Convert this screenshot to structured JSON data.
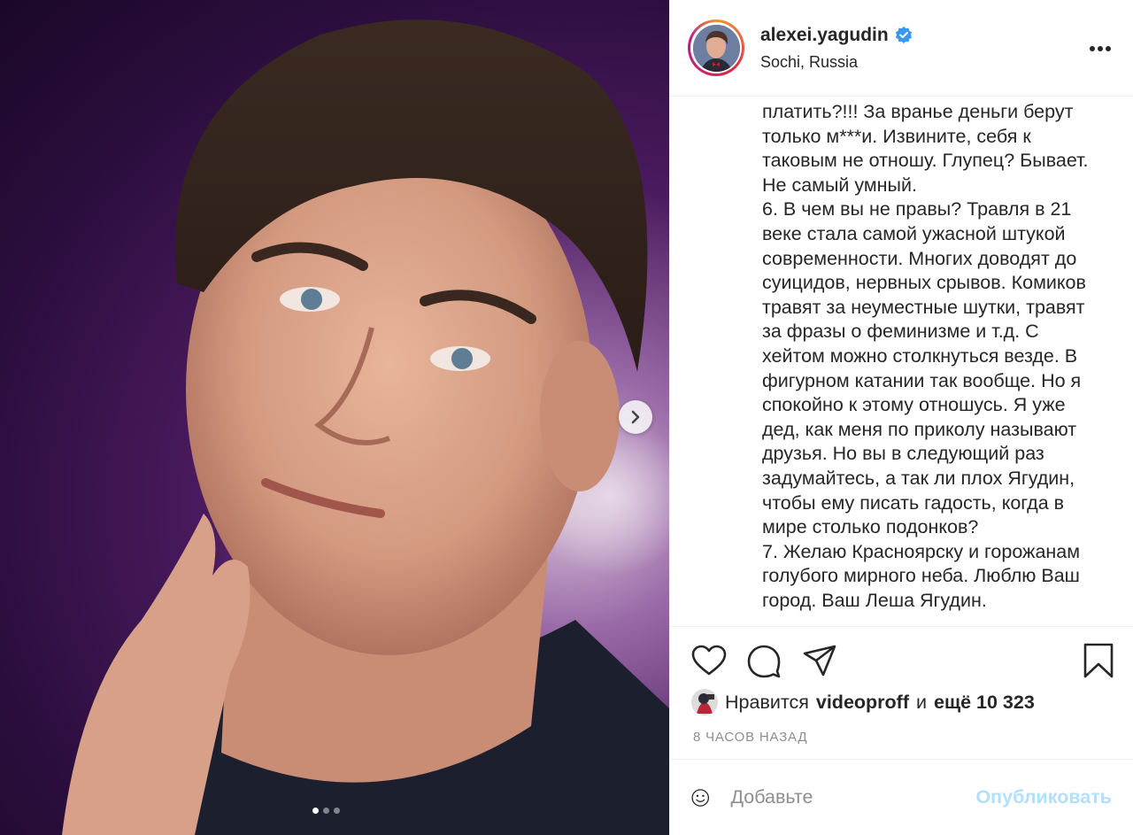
{
  "post": {
    "username": "alexei.yagudin",
    "location": "Sochi, Russia",
    "verified": true,
    "caption": "платить?!!! За вранье деньги берут\nтолько м***и. Извините, себя к\nтаковым не отношу. Глупец? Бывает.\nНе самый умный.\n6. В чем вы не правы? Травля в 21\nвеке стала самой ужасной штукой\nсовременности. Многих доводят до\nсуицидов, нервных срывов. Комиков\nтравят за неуместные шутки, травят\nза фразы о феминизме и т.д. С\nхейтом можно столкнуться везде. В\nфигурном катании так вообще. Но я\nспокойно к этому отношусь. Я уже\nдед, как меня по приколу называют\nдрузья. Но вы в следующий раз\nзадумайтесь, а так ли плох Ягудин,\nчтобы ему писать гадость, когда в\nмире столько подонков?\n7. Желаю Красноярску и горожанам\nголубого мирного неба. Люблю Ваш\nгород. Ваш Леша Ягудин.",
    "carousel": {
      "total": 3,
      "active": 1
    }
  },
  "likes": {
    "prefix": "Нравится",
    "liker": "videoproff",
    "joiner": "и",
    "others": "ещё 10 323"
  },
  "timestamp": "8 ЧАСОВ НАЗАД",
  "comment": {
    "placeholder": "Добавьте",
    "publish_label": "Опубликовать"
  },
  "colors": {
    "verified_blue": "#3897f0",
    "publish_disabled": "#b2dffc",
    "muted_text": "#8e8e8e"
  },
  "icons": [
    "next-arrow-icon",
    "more-options-icon",
    "heart-icon",
    "comment-icon",
    "share-icon",
    "bookmark-icon",
    "emoji-icon",
    "verified-badge-icon"
  ]
}
